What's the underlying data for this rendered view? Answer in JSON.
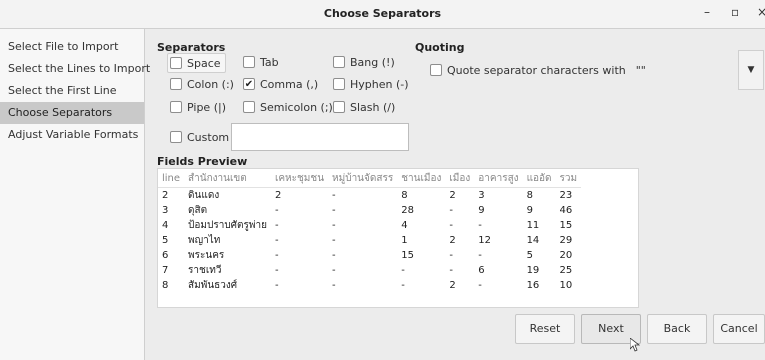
{
  "window": {
    "title": "Choose Separators",
    "minimize": "–",
    "maximize": "▫",
    "close": "×"
  },
  "sidebar": {
    "items": [
      {
        "label": "Select File to Import"
      },
      {
        "label": "Select the Lines to Import"
      },
      {
        "label": "Select the First Line"
      },
      {
        "label": "Choose Separators"
      },
      {
        "label": "Adjust Variable Formats"
      }
    ]
  },
  "separators": {
    "title": "Separators",
    "space": "Space",
    "tab": "Tab",
    "bang": "Bang (!)",
    "colon": "Colon (:)",
    "comma": "Comma (,)",
    "hyphen": "Hyphen (-)",
    "pipe": "Pipe (|)",
    "semicolon": "Semicolon (;)",
    "slash": "Slash (/)",
    "custom": "Custom",
    "custom_value": ""
  },
  "quoting": {
    "title": "Quoting",
    "label": "Quote separator characters with",
    "value": "\"\""
  },
  "preview": {
    "title": "Fields Preview",
    "headers": [
      "line",
      "สำนักงานเขต",
      "เคหะชุมชน",
      "หมู่บ้านจัดสรร",
      "ชานเมือง",
      "เมือง",
      "อาคารสูง",
      "แออัด",
      "รวม"
    ],
    "rows": [
      [
        "2",
        "ดินแดง",
        "2",
        "-",
        "8",
        "2",
        "3",
        "8",
        "23"
      ],
      [
        "3",
        "ดุสิต",
        "-",
        "-",
        "28",
        "-",
        "9",
        "9",
        "46"
      ],
      [
        "4",
        "ป้อมปราบศัตรูพ่าย",
        "-",
        "-",
        "4",
        "-",
        "-",
        "11",
        "15"
      ],
      [
        "5",
        "พญาไท",
        "-",
        "-",
        "1",
        "2",
        "12",
        "14",
        "29"
      ],
      [
        "6",
        "พระนคร",
        "-",
        "-",
        "15",
        "-",
        "-",
        "5",
        "20"
      ],
      [
        "7",
        "ราชเทวี",
        "-",
        "-",
        "-",
        "-",
        "6",
        "19",
        "25"
      ],
      [
        "8",
        "สัมพันธวงศ์",
        "-",
        "-",
        "-",
        "2",
        "-",
        "16",
        "10"
      ]
    ]
  },
  "buttons": {
    "reset": "Reset",
    "next": "Next",
    "back": "Back",
    "cancel": "Cancel"
  }
}
